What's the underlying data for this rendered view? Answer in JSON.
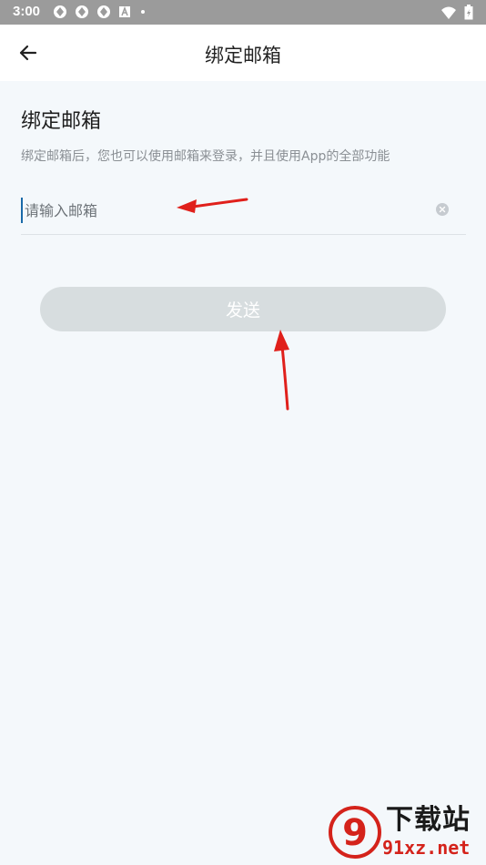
{
  "status_bar": {
    "time": "3:00",
    "left_icons": [
      "app-notification-icon",
      "app-notification-icon",
      "app-notification-icon",
      "font-notification-icon",
      "dot-icon"
    ],
    "right_icons": [
      "wifi-icon",
      "battery-icon"
    ],
    "background": "#9b9b9b"
  },
  "app_bar": {
    "title": "绑定邮箱",
    "back_icon": "arrow-left-icon"
  },
  "main": {
    "heading": "绑定邮箱",
    "description": "绑定邮箱后，您也可以使用邮箱来登录，并且使用App的全部功能",
    "email_field": {
      "value": "",
      "placeholder": "请输入邮箱",
      "clear_icon": "clear-circle-icon"
    },
    "send_button": {
      "label": "发送",
      "enabled": false
    }
  },
  "annotations": {
    "arrow_color": "#e0201b",
    "arrows": [
      "pointing-to-email-field",
      "pointing-to-send-button"
    ]
  },
  "watermark": {
    "logo_text": "9",
    "text_top": "下载站",
    "text_bottom": "91xz.net",
    "brand_color": "#d4231b"
  },
  "colors": {
    "page_background": "#f4f8fb",
    "button_disabled": "#d7dddf",
    "cursor": "#1a6aa8"
  }
}
